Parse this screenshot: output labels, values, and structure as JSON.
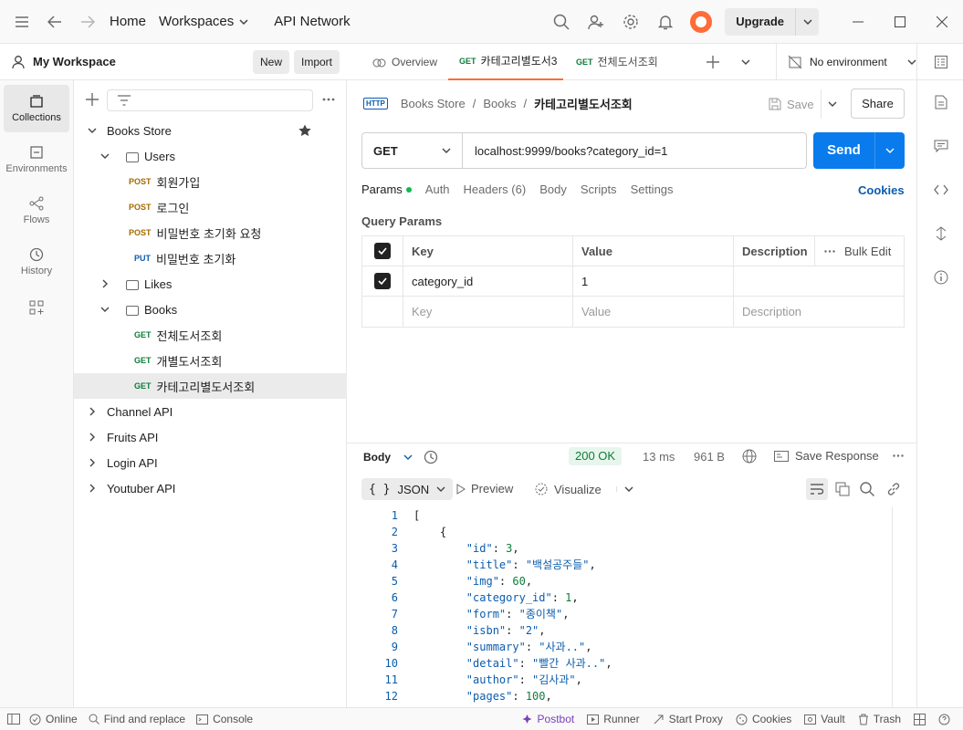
{
  "titlebar": {
    "home": "Home",
    "workspaces": "Workspaces",
    "api_network": "API Network",
    "upgrade": "Upgrade"
  },
  "rail": {
    "items": [
      {
        "label": "Collections"
      },
      {
        "label": "Environments"
      },
      {
        "label": "Flows"
      },
      {
        "label": "History"
      }
    ]
  },
  "workspace": {
    "name": "My Workspace",
    "new_label": "New",
    "import_label": "Import"
  },
  "tree": {
    "collection": "Books Store",
    "users_folder": "Users",
    "users": [
      {
        "method": "POST",
        "name": "회원가입"
      },
      {
        "method": "POST",
        "name": "로그인"
      },
      {
        "method": "POST",
        "name": "비밀번호 초기화 요청"
      },
      {
        "method": "PUT",
        "name": "비밀번호 초기화"
      }
    ],
    "likes_folder": "Likes",
    "books_folder": "Books",
    "books": [
      {
        "method": "GET",
        "name": "전체도서조회"
      },
      {
        "method": "GET",
        "name": "개별도서조회"
      },
      {
        "method": "GET",
        "name": "카테고리별도서조회"
      }
    ],
    "collections": [
      "Channel API",
      "Fruits API",
      "Login API",
      "Youtuber API"
    ]
  },
  "tabs": {
    "overview": "Overview",
    "tab1_method": "GET",
    "tab1_name": "카테고리별도서3",
    "tab2_method": "GET",
    "tab2_name": "전체도서조회",
    "environment": "No environment"
  },
  "request": {
    "breadcrumb": [
      "Books Store",
      "Books",
      "카테고리별도서조회"
    ],
    "http_icon": "HTTP",
    "save_label": "Save",
    "share_label": "Share",
    "method": "GET",
    "url": "localhost:9999/books?category_id=1",
    "send_label": "Send",
    "tabs": [
      "Params",
      "Auth",
      "Headers (6)",
      "Body",
      "Scripts",
      "Settings"
    ],
    "cookies_label": "Cookies",
    "query_params_label": "Query Params",
    "table_headers": [
      "Key",
      "Value",
      "Description"
    ],
    "bulk_edit": "Bulk Edit",
    "params": [
      {
        "key": "category_id",
        "value": "1",
        "description": ""
      }
    ],
    "placeholder": {
      "key": "Key",
      "value": "Value",
      "description": "Description"
    }
  },
  "response": {
    "body_label": "Body",
    "status": "200 OK",
    "time": "13 ms",
    "size": "961 B",
    "save_response": "Save Response",
    "format": "JSON",
    "preview": "Preview",
    "visualize": "Visualize",
    "line_numbers": [
      "1",
      "2",
      "3",
      "4",
      "5",
      "6",
      "7",
      "8",
      "9",
      "10",
      "11",
      "12"
    ]
  },
  "statusbar": {
    "online": "Online",
    "find_replace": "Find and replace",
    "console": "Console",
    "postbot": "Postbot",
    "runner": "Runner",
    "start_proxy": "Start Proxy",
    "cookies": "Cookies",
    "vault": "Vault",
    "trash": "Trash"
  },
  "colors": {
    "accent": "#ff6c37",
    "send": "#097bed",
    "get": "#0f7b3a",
    "post": "#a36a00",
    "put": "#0b5cad"
  }
}
